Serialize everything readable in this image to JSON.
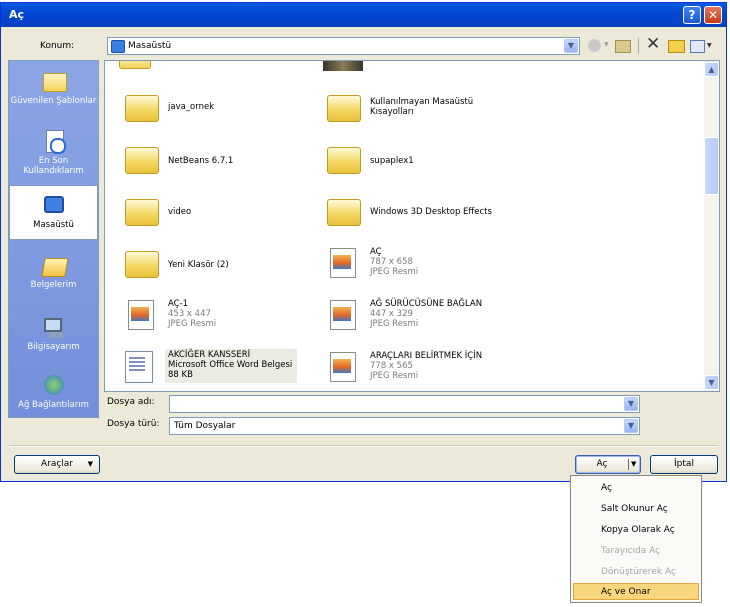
{
  "window": {
    "title": "Aç",
    "help_glyph": "?",
    "close_glyph": "✕"
  },
  "location": {
    "label": "Konum:",
    "value": "Masaüstü"
  },
  "places": [
    {
      "label": "Güvenilen Şablonlar"
    },
    {
      "label": "En Son Kullandıklarım"
    },
    {
      "label": "Masaüstü"
    },
    {
      "label": "Belgelerim"
    },
    {
      "label": "Bilgisayarım"
    },
    {
      "label": "Ağ Bağlantılarım"
    }
  ],
  "files": [
    {
      "name": "java_ornek",
      "line2": "",
      "line3": "",
      "kind": "folder"
    },
    {
      "name": "Kullanılmayan Masaüstü",
      "line2": "Kısayolları",
      "line3": "",
      "kind": "folder"
    },
    {
      "name": "NetBeans 6.7.1",
      "line2": "",
      "line3": "",
      "kind": "folder"
    },
    {
      "name": "supaplex1",
      "line2": "",
      "line3": "",
      "kind": "folder"
    },
    {
      "name": "video",
      "line2": "",
      "line3": "",
      "kind": "folder"
    },
    {
      "name": "Windows 3D Desktop Effects",
      "line2": "",
      "line3": "",
      "kind": "folder"
    },
    {
      "name": "Yeni Klasör (2)",
      "line2": "",
      "line3": "",
      "kind": "folder"
    },
    {
      "name": "AÇ",
      "line2": "787 x 658",
      "line3": "JPEG Resmi",
      "kind": "image"
    },
    {
      "name": "AÇ-1",
      "line2": "453 x 447",
      "line3": "JPEG Resmi",
      "kind": "image"
    },
    {
      "name": "AĞ SÜRÜCÜSÜNE BAĞLAN",
      "line2": "447 x 329",
      "line3": "JPEG Resmi",
      "kind": "image"
    },
    {
      "name": "AKCİĞER KANSSERİ",
      "line2": "Microsoft Office Word Belgesi",
      "line3": "88 KB",
      "kind": "word"
    },
    {
      "name": "ARAÇLARI BELİRTMEK İÇİN",
      "line2": "778 x 565",
      "line3": "JPEG Resmi",
      "kind": "image"
    }
  ],
  "filename": {
    "label": "Dosya adı:",
    "value": ""
  },
  "filetype": {
    "label": "Dosya türü:",
    "value": "Tüm Dosyalar"
  },
  "buttons": {
    "tools": "Araçlar",
    "open": "Aç",
    "cancel": "İptal"
  },
  "open_menu": [
    {
      "label": "Aç",
      "enabled": true
    },
    {
      "label": "Salt Okunur Aç",
      "enabled": true
    },
    {
      "label": "Kopya Olarak Aç",
      "enabled": true
    },
    {
      "label": "Tarayıcıda Aç",
      "enabled": false
    },
    {
      "label": "Dönüştürerek Aç",
      "enabled": false
    },
    {
      "label": "Aç ve Onar",
      "enabled": true,
      "highlighted": true
    }
  ]
}
